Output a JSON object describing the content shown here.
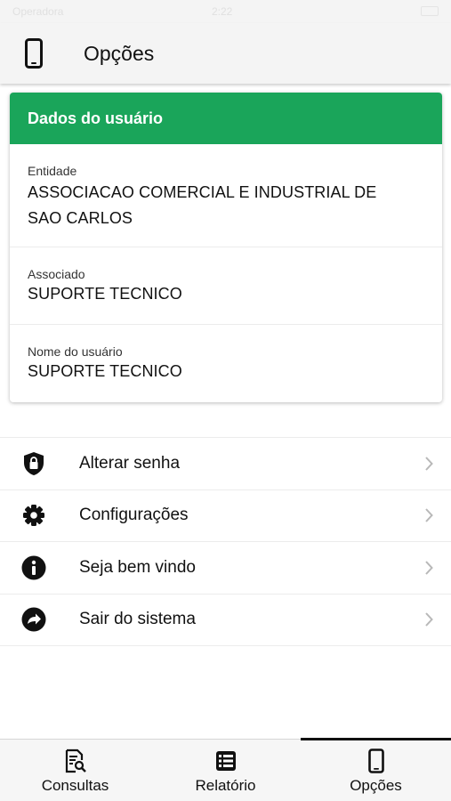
{
  "status_bar": {
    "carrier": "Operadora",
    "time": "2:22"
  },
  "header": {
    "title": "Opções",
    "icon": "phone-icon"
  },
  "user_card": {
    "title": "Dados do usuário",
    "header_color": "#1aa55a",
    "fields": [
      {
        "label": "Entidade",
        "value": "ASSOCIACAO COMERCIAL E INDUSTRIAL DE SAO CARLOS"
      },
      {
        "label": "Associado",
        "value": "SUPORTE TECNICO"
      },
      {
        "label": "Nome do usuário",
        "value": "SUPORTE TECNICO"
      }
    ]
  },
  "menu": {
    "items": [
      {
        "label": "Alterar senha",
        "icon": "shield-lock-icon"
      },
      {
        "label": "Configurações",
        "icon": "gear-icon"
      },
      {
        "label": "Seja bem vindo",
        "icon": "info-icon"
      },
      {
        "label": "Sair do sistema",
        "icon": "share-arrow-icon"
      }
    ]
  },
  "tabbar": {
    "active": "Opções",
    "tabs": [
      {
        "label": "Consultas",
        "icon": "document-search-icon"
      },
      {
        "label": "Relatório",
        "icon": "list-icon"
      },
      {
        "label": "Opções",
        "icon": "phone-icon"
      }
    ]
  }
}
